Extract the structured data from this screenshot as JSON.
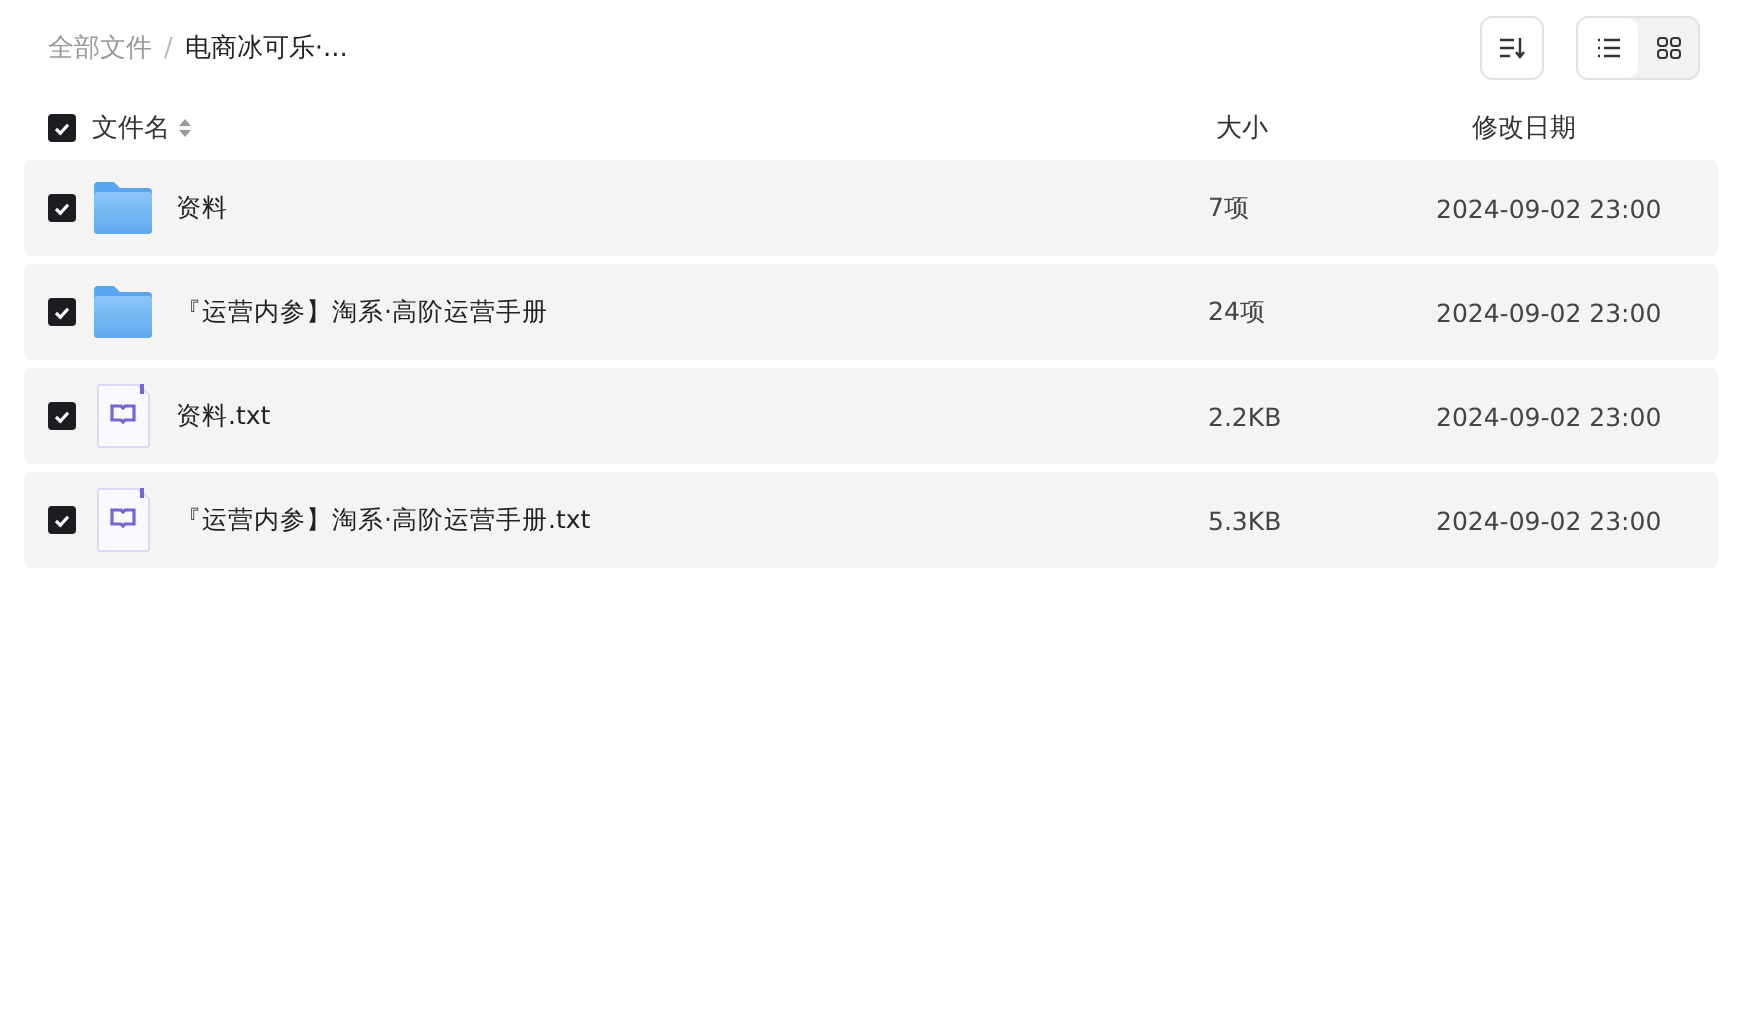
{
  "breadcrumb_separator": "/",
  "breadcrumb": [
    {
      "label": "全部文件",
      "current": false
    },
    {
      "label": "电商冰可乐·...",
      "current": true
    }
  ],
  "toolbar": {
    "view_modes": [
      {
        "kind": "list",
        "selected": true
      },
      {
        "kind": "grid",
        "selected": false
      }
    ]
  },
  "table": {
    "select_all_checked": true,
    "columns": [
      "文件名",
      "大小",
      "修改日期"
    ],
    "rows": [
      {
        "kind": "folder",
        "checked": true,
        "name": "资料",
        "size": "7项",
        "modified": "2024-09-02 23:00"
      },
      {
        "kind": "folder",
        "checked": true,
        "name": "『运营内参】淘系·高阶运营手册",
        "size": "24项",
        "modified": "2024-09-02 23:00"
      },
      {
        "kind": "txt",
        "checked": true,
        "name": "资料.txt",
        "size": "2.2KB",
        "modified": "2024-09-02 23:00"
      },
      {
        "kind": "txt",
        "checked": true,
        "name": "『运营内参】淘系·高阶运营手册.txt",
        "size": "5.3KB",
        "modified": "2024-09-02 23:00"
      }
    ]
  }
}
